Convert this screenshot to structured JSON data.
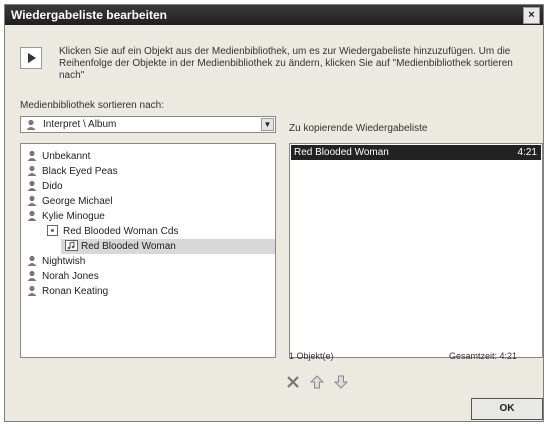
{
  "window": {
    "title": "Wiedergabeliste bearbeiten",
    "close_label": "×"
  },
  "info": {
    "text": "Klicken Sie auf ein Objekt aus der Medienbibliothek, um es zur Wiedergabeliste hinzuzufügen. Um die Reihenfolge der Objekte in der Medienbibliothek zu ändern, klicken Sie auf \"Medienbibliothek sortieren nach\""
  },
  "sort": {
    "label": "Medienbibliothek sortieren nach:",
    "selected": "Interpret \\ Album"
  },
  "tree": {
    "artists_before": [
      "Unbekannt",
      "Black Eyed Peas",
      "Dido",
      "George Michael",
      "Kylie Minogue"
    ],
    "album": "Red Blooded Woman Cds",
    "track": "Red Blooded Woman",
    "artists_after": [
      "Nightwish",
      "Norah Jones",
      "Ronan Keating"
    ]
  },
  "playlist": {
    "label": "Zu kopierende Wiedergabeliste",
    "items": [
      {
        "title": "Red Blooded Woman",
        "duration": "4:21"
      }
    ],
    "count_text": "1 Objekt(e)",
    "total_text": "Gesamtzeit: 4:21"
  },
  "buttons": {
    "ok": "OK"
  },
  "colors": {
    "title_bar": "#2a2a2a",
    "selection": "#222222",
    "dialog_bg": "#ece9e0"
  }
}
